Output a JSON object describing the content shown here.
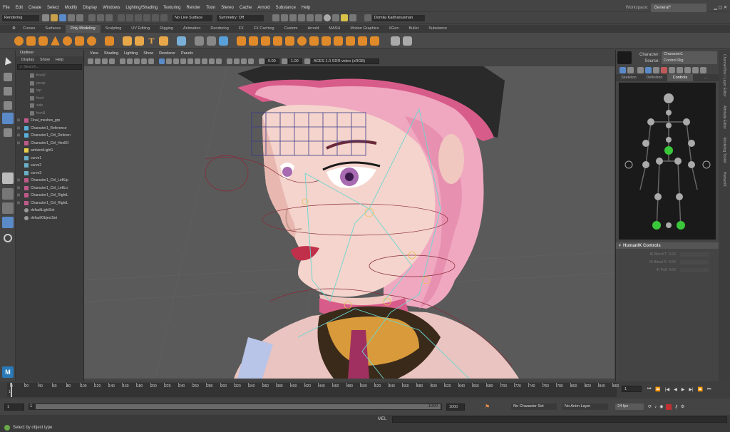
{
  "menu": [
    "File",
    "Edit",
    "Create",
    "Select",
    "Modify",
    "Display",
    "Windows",
    "Lighting/Shading",
    "Texturing",
    "Render",
    "Toon",
    "Stereo",
    "Cache",
    "Arnold",
    "Substance",
    "Help"
  ],
  "workspace": {
    "label": "Workspace:",
    "value": "General*"
  },
  "toolbar": {
    "mode": "Rendering",
    "live_surface": "No Live Surface",
    "symmetry": "Symmetry: Off",
    "user": "Domila Kadhanusman"
  },
  "shelf_tabs": [
    "Curves",
    "Surfaces",
    "Poly Modeling",
    "Sculpting",
    "UV Editing",
    "Rigging",
    "Animation",
    "Rendering",
    "FX",
    "FX Caching",
    "Custom",
    "Arnold",
    "MASH",
    "Motion Graphics",
    "XGen",
    "Bullet",
    "Substance"
  ],
  "active_shelf_tab": "Poly Modeling",
  "outliner": {
    "title": "Outliner",
    "menu": [
      "Display",
      "Show",
      "Help"
    ],
    "search_placeholder": "Search...",
    "items": [
      {
        "label": "front2",
        "type": "camera",
        "indent": 1,
        "expand": false
      },
      {
        "label": "persp",
        "type": "camera",
        "indent": 1,
        "expand": false
      },
      {
        "label": "top",
        "type": "camera",
        "indent": 1,
        "expand": false
      },
      {
        "label": "front",
        "type": "camera",
        "indent": 1,
        "expand": false
      },
      {
        "label": "side",
        "type": "camera",
        "indent": 1,
        "expand": false
      },
      {
        "label": "front1",
        "type": "camera",
        "indent": 1,
        "expand": false
      },
      {
        "label": "Final_meshes_grp",
        "type": "group",
        "indent": 0,
        "expand": true
      },
      {
        "label": "Character1_Reference",
        "type": "joint",
        "indent": 0,
        "expand": true
      },
      {
        "label": "Character1_Ctrl_Referen",
        "type": "joint",
        "indent": 0,
        "expand": true
      },
      {
        "label": "Character1_Ctrl_HeelEf",
        "type": "group",
        "indent": 0,
        "expand": true
      },
      {
        "label": "ambientLight1",
        "type": "light",
        "indent": 0,
        "expand": false
      },
      {
        "label": "curve1",
        "type": "curve",
        "indent": 0,
        "expand": false
      },
      {
        "label": "curve2",
        "type": "curve",
        "indent": 0,
        "expand": false
      },
      {
        "label": "curve3",
        "type": "curve",
        "indent": 0,
        "expand": false
      },
      {
        "label": "Character1_Ctrl_LeftUp",
        "type": "group",
        "indent": 0,
        "expand": true
      },
      {
        "label": "Character1_Ctrl_LeftLo",
        "type": "group",
        "indent": 0,
        "expand": true
      },
      {
        "label": "Character1_Ctrl_RightL",
        "type": "group",
        "indent": 0,
        "expand": true
      },
      {
        "label": "Character1_Ctrl_RightL",
        "type": "group",
        "indent": 0,
        "expand": true
      },
      {
        "label": "defaultLightSet",
        "type": "set",
        "indent": 0,
        "expand": false
      },
      {
        "label": "defaultObjectSet",
        "type": "set",
        "indent": 0,
        "expand": false
      }
    ]
  },
  "viewport_menu": [
    "View",
    "Shading",
    "Lighting",
    "Show",
    "Renderer",
    "Panels"
  ],
  "viewport_fields": {
    "exposure": "0.00",
    "gamma": "1.00",
    "colorspace": "ACES 1.0 SDR-video (sRGB)"
  },
  "hik": {
    "character_label": "Character:",
    "character": "Character1",
    "source_label": "Source:",
    "source": "Control Rig",
    "tabs": [
      "Skeleton",
      "Definition",
      "Controls",
      "..."
    ],
    "active_tab": "Controls",
    "controls_title": "HumanIK Controls",
    "sliders": [
      {
        "label": "IK Blend T",
        "value": "0.00"
      },
      {
        "label": "IK Blend R",
        "value": "0.00"
      },
      {
        "label": "IK Pull",
        "value": "0.00"
      }
    ]
  },
  "side_tabs": [
    "Channel Box / Layer Editor",
    "Attribute Editor",
    "Modeling Toolkit",
    "HumanIK"
  ],
  "timeline": {
    "ticks": [
      "0",
      "20",
      "40",
      "60",
      "80",
      "100",
      "120",
      "140",
      "160",
      "180",
      "200",
      "220",
      "240",
      "260",
      "280",
      "300",
      "320",
      "340",
      "360",
      "380",
      "400",
      "420",
      "440",
      "460",
      "480",
      "500",
      "520",
      "540",
      "560",
      "580",
      "600",
      "620",
      "640",
      "660",
      "680",
      "700",
      "720",
      "740",
      "760",
      "780",
      "800",
      "820",
      "840",
      "860"
    ],
    "first_tick_sub": "1",
    "current_frame": "1"
  },
  "range": {
    "start": "1",
    "inner_start": "1",
    "inner_end": "1000",
    "end": "1000",
    "character_set": "No Character Set",
    "anim_layer": "No Anim Layer",
    "fps": "24 fps"
  },
  "cmd": {
    "lang": "MEL"
  },
  "help": {
    "text": "Select by object type"
  }
}
